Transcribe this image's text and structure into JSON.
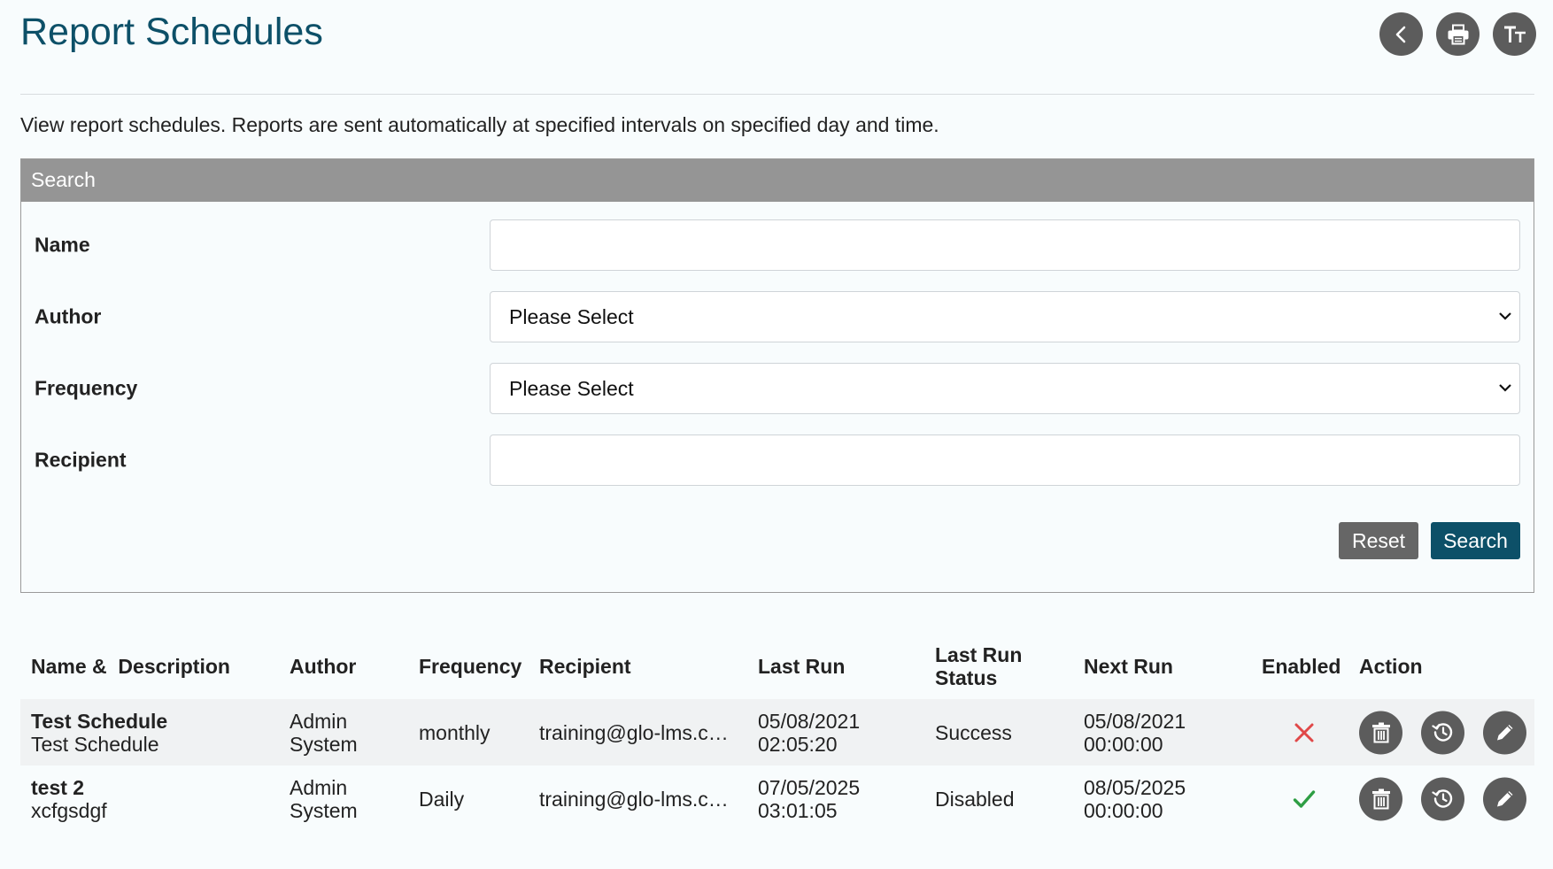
{
  "header": {
    "title": "Report Schedules",
    "actions": [
      {
        "name": "back",
        "icon": "chevron-left-icon"
      },
      {
        "name": "print",
        "icon": "printer-icon"
      },
      {
        "name": "text-size",
        "icon": "text-size-icon"
      }
    ]
  },
  "intro": "View report schedules. Reports are sent automatically at specified intervals on specified day and time.",
  "search": {
    "heading": "Search",
    "fields": {
      "name": {
        "label": "Name",
        "value": ""
      },
      "author": {
        "label": "Author",
        "selected": "Please Select"
      },
      "frequency": {
        "label": "Frequency",
        "selected": "Please Select"
      },
      "recipient": {
        "label": "Recipient",
        "value": ""
      }
    },
    "reset_label": "Reset",
    "search_label": "Search"
  },
  "table": {
    "headers": {
      "name": "Name &  Description",
      "author": "Author",
      "frequency": "Frequency",
      "recipient": "Recipient",
      "last_run": "Last Run",
      "last_run_status_1": "Last Run",
      "last_run_status_2": "Status",
      "next_run": "Next Run",
      "enabled": "Enabled",
      "action": "Action"
    },
    "rows": [
      {
        "name": "Test Schedule",
        "description": "Test Schedule",
        "author_1": "Admin",
        "author_2": "System",
        "frequency": "monthly",
        "recipient": "training@glo-lms.com",
        "last_run_date": "05/08/2021",
        "last_run_time": "02:05:20",
        "status": "Success",
        "next_run_date": "05/08/2021",
        "next_run_time": "00:00:00",
        "enabled": false
      },
      {
        "name": "test 2",
        "description": "xcfgsdgf",
        "author_1": "Admin",
        "author_2": "System",
        "frequency": "Daily",
        "recipient": "training@glo-lms.com",
        "last_run_date": "07/05/2025",
        "last_run_time": "03:01:05",
        "status": "Disabled",
        "next_run_date": "08/05/2025",
        "next_run_time": "00:00:00",
        "enabled": true
      }
    ]
  },
  "colors": {
    "title": "#0d5068",
    "primary_button": "#0d5068",
    "icon_button": "#5c5c5c",
    "panel_header": "#959595",
    "enabled_yes": "#2e9e44",
    "enabled_no": "#e04848"
  }
}
